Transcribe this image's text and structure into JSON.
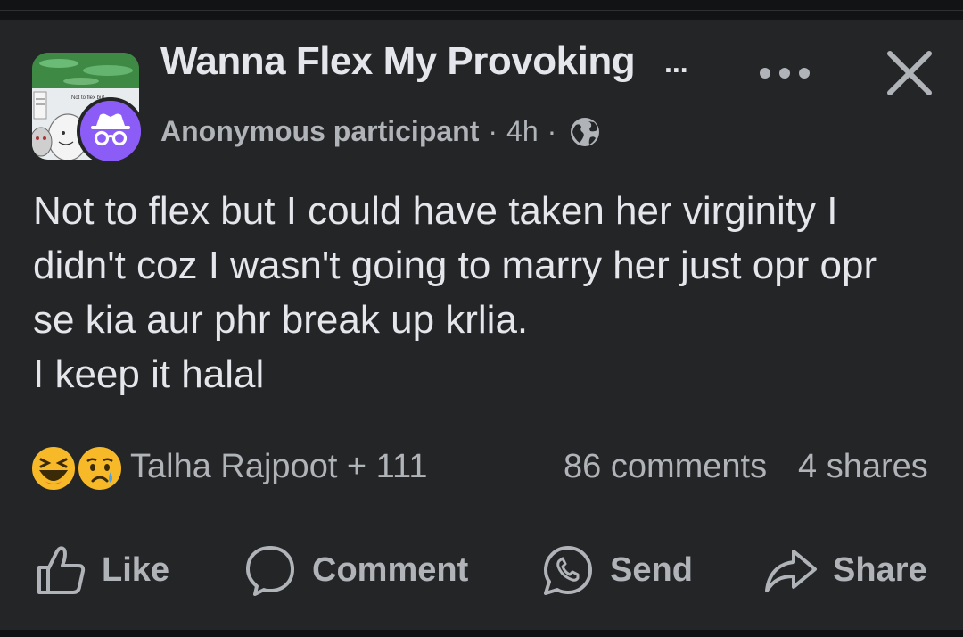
{
  "post": {
    "group_title": "Wanna Flex My Provoking",
    "group_title_ellipsis": "...",
    "author": "Anonymous participant",
    "separator": "·",
    "time": "4h",
    "text": "Not to flex but I could have taken her virginity I didn't coz I wasn't going to marry her just opr opr se kia aur phr break up krlia.\nI keep it halal",
    "group_avatar_text": [
      "Not to flex but",
      "I"
    ],
    "privacy_icon": "globe-icon"
  },
  "engagement": {
    "reactions": [
      "haha",
      "sad"
    ],
    "reactors": "Talha Rajpoot + 111",
    "comments": "86 comments",
    "shares": "4 shares"
  },
  "actions": {
    "like": "Like",
    "comment": "Comment",
    "send": "Send",
    "share": "Share"
  },
  "colors": {
    "background": "#242526",
    "text_primary": "#e4e6eb",
    "text_secondary": "#b0b3b8",
    "anon_avatar": "#8b5cf6"
  }
}
